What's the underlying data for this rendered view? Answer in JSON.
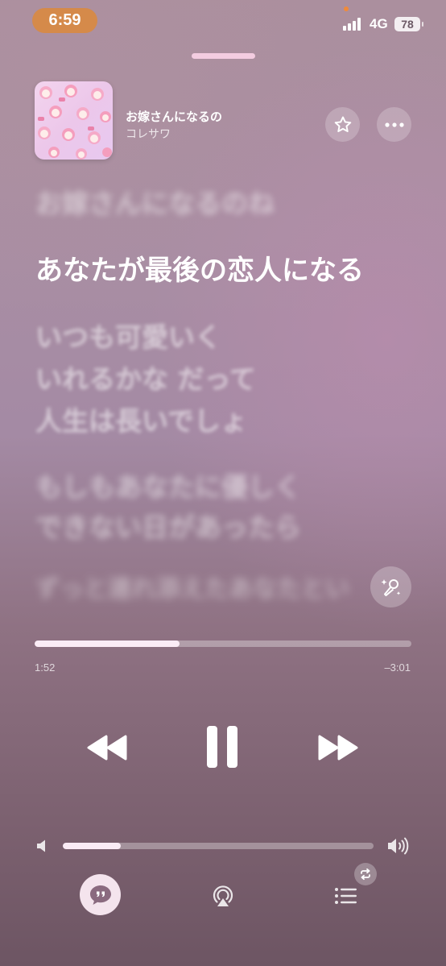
{
  "status_bar": {
    "time": "6:59",
    "network": "4G",
    "battery": "78"
  },
  "now_playing": {
    "title": "お嫁さんになるの",
    "artist": "コレサワ",
    "favorite_icon": "star-outline-icon",
    "more_icon": "ellipsis-icon"
  },
  "lyrics": {
    "previous": "お嫁さんになるのね",
    "current": "あなたが最後の恋人になる",
    "upcoming_1": [
      "いつも可愛いく",
      "いれるかな だって",
      "人生は長いでしょ"
    ],
    "upcoming_2": [
      "もしもあなたに優しく",
      "できない日があったら"
    ],
    "upcoming_3": "ずっと連れ添えたあなたとい"
  },
  "progress": {
    "elapsed": "1:52",
    "remaining": "–3:01",
    "fraction": 0.385
  },
  "volume": {
    "fraction": 0.186
  },
  "controls": {
    "rewind_icon": "rewind-icon",
    "pause_icon": "pause-icon",
    "forward_icon": "fast-forward-icon",
    "sing_icon": "microphone-sparkle-icon"
  },
  "bottom_bar": {
    "lyrics_icon": "quote-bubble-icon",
    "airplay_icon": "airplay-icon",
    "queue_icon": "list-icon",
    "repeat_badge_icon": "repeat-icon"
  },
  "colors": {
    "time_pill": "#d58a4a",
    "accent_recording_dot": "#f08a3a"
  }
}
